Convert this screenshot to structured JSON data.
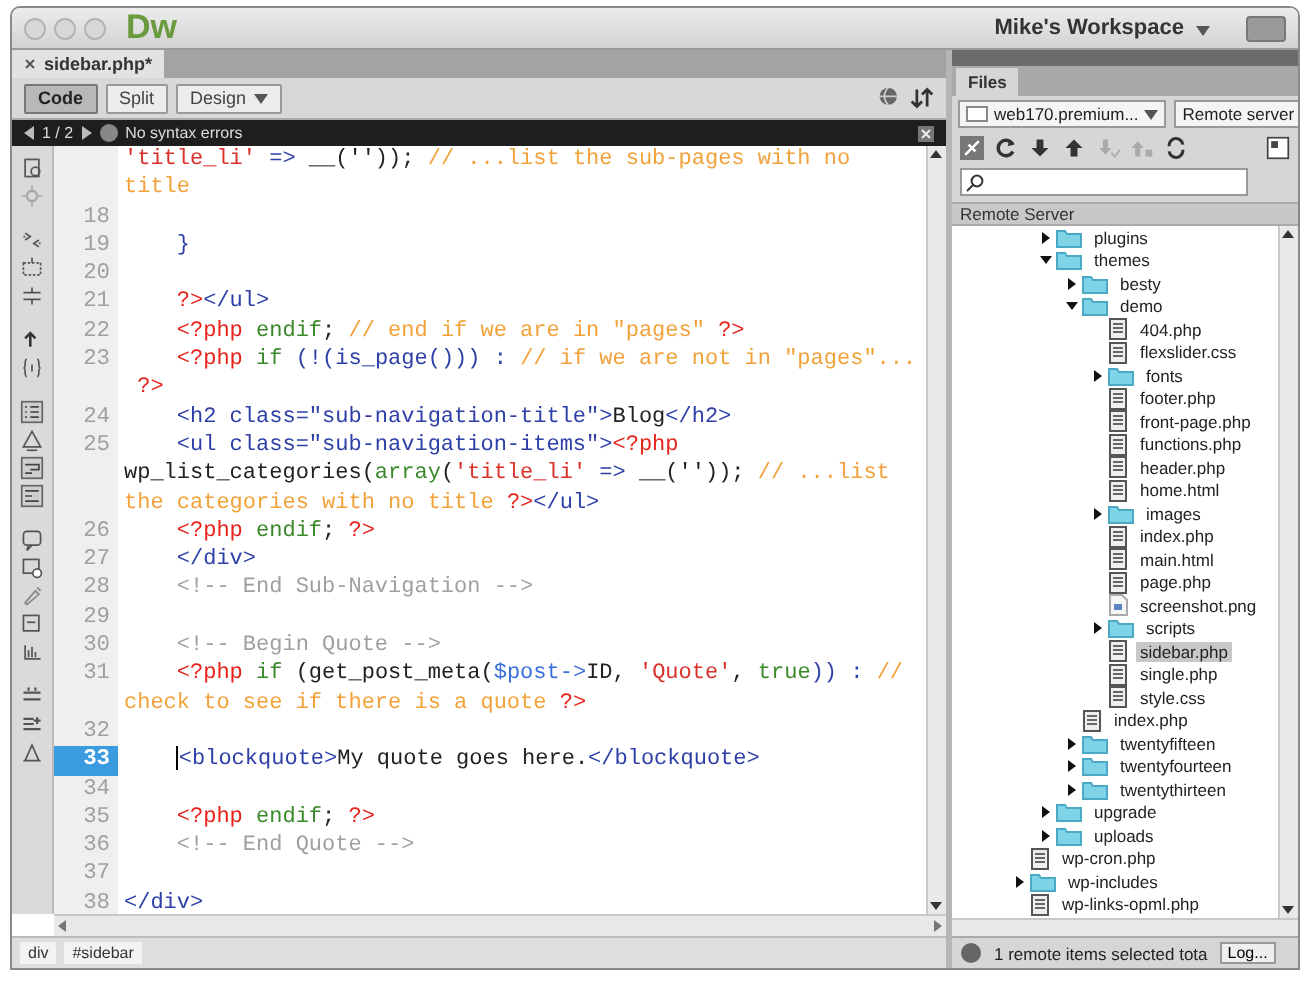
{
  "window": {
    "app_name": "Dw",
    "workspace": "Mike's Workspace"
  },
  "editor": {
    "tab": {
      "label": "sidebar.php*",
      "selected": true
    },
    "view_buttons": [
      {
        "label": "Code",
        "selected": true
      },
      {
        "label": "Split",
        "selected": false
      },
      {
        "label": "Design",
        "selected": false
      }
    ],
    "info_bar": {
      "pager": "1 / 2",
      "message": "No syntax errors"
    },
    "lines": [
      {
        "tokens": [
          {
            "kind": "string",
            "text": "'title_li'"
          },
          {
            "kind": "operator",
            "text": " => "
          },
          {
            "kind": "text",
            "text": "__('')); "
          },
          {
            "kind": "comment",
            "text": "// ...list the sub-pages with no"
          }
        ]
      },
      {
        "tokens": [
          {
            "kind": "comment",
            "text": "title"
          }
        ]
      },
      {
        "number": "18",
        "current": false
      },
      {
        "number": "19",
        "current": false,
        "tokens": [
          {
            "kind": "tag",
            "text": "    }"
          }
        ]
      },
      {
        "number": "20",
        "current": false
      },
      {
        "number": "21",
        "current": false,
        "tokens": [
          {
            "kind": "php",
            "text": "    ?>"
          },
          {
            "kind": "tag",
            "text": "</ul>"
          }
        ]
      },
      {
        "number": "22",
        "current": false,
        "tokens": [
          {
            "kind": "php",
            "text": "    <?php"
          },
          {
            "kind": "keyword",
            "text": " endif"
          },
          {
            "kind": "text",
            "text": "; "
          },
          {
            "kind": "comment",
            "text": "// end if we are in \"pages\" "
          },
          {
            "kind": "php",
            "text": "?>"
          }
        ]
      },
      {
        "number": "23",
        "current": false,
        "tokens": [
          {
            "kind": "php",
            "text": "    <?php"
          },
          {
            "kind": "keyword",
            "text": " if"
          },
          {
            "kind": "operator",
            "text": " (!(is_page())) : "
          },
          {
            "kind": "comment",
            "text": "// if we are not in \"pages\"..."
          }
        ]
      },
      {
        "tokens": [
          {
            "kind": "php",
            "text": " ?>"
          }
        ]
      },
      {
        "number": "24",
        "current": false,
        "tokens": [
          {
            "kind": "tag",
            "text": "    <h2 class=\"sub-navigation-title\">"
          },
          {
            "kind": "text",
            "text": "Blog"
          },
          {
            "kind": "tag",
            "text": "</h2>"
          }
        ]
      },
      {
        "number": "25",
        "current": false,
        "tokens": [
          {
            "kind": "tag",
            "text": "    <ul class=\"sub-navigation-items\">"
          },
          {
            "kind": "php",
            "text": "<?php"
          }
        ]
      },
      {
        "tokens": [
          {
            "kind": "text",
            "text": "wp_list_categories("
          },
          {
            "kind": "keyword",
            "text": "array"
          },
          {
            "kind": "text",
            "text": "("
          },
          {
            "kind": "string",
            "text": "'title_li'"
          },
          {
            "kind": "operator",
            "text": " => "
          },
          {
            "kind": "text",
            "text": "__('')); "
          },
          {
            "kind": "comment",
            "text": "// ...list"
          }
        ]
      },
      {
        "tokens": [
          {
            "kind": "comment",
            "text": "the categories with no title "
          },
          {
            "kind": "php",
            "text": "?>"
          },
          {
            "kind": "tag",
            "text": "</ul>"
          }
        ]
      },
      {
        "number": "26",
        "current": false,
        "tokens": [
          {
            "kind": "php",
            "text": "    <?php"
          },
          {
            "kind": "keyword",
            "text": " endif"
          },
          {
            "kind": "text",
            "text": "; "
          },
          {
            "kind": "php",
            "text": "?>"
          }
        ]
      },
      {
        "number": "27",
        "current": false,
        "tokens": [
          {
            "kind": "tag",
            "text": "    </div>"
          }
        ]
      },
      {
        "number": "28",
        "current": false,
        "tokens": [
          {
            "kind": "html_comment",
            "text": "    <!-- End Sub-Navigation -->"
          }
        ]
      },
      {
        "number": "29",
        "current": false
      },
      {
        "number": "30",
        "current": false,
        "tokens": [
          {
            "kind": "html_comment",
            "text": "    <!-- Begin Quote -->"
          }
        ]
      },
      {
        "number": "31",
        "current": false,
        "tokens": [
          {
            "kind": "php",
            "text": "    <?php"
          },
          {
            "kind": "keyword",
            "text": " if"
          },
          {
            "kind": "text",
            "text": " (get_post_meta("
          },
          {
            "kind": "variable",
            "text": "$post->"
          },
          {
            "kind": "text",
            "text": "ID, "
          },
          {
            "kind": "string",
            "text": "'Quote'"
          },
          {
            "kind": "text",
            "text": ", "
          },
          {
            "kind": "keyword",
            "text": "true"
          },
          {
            "kind": "operator",
            "text": ")) : "
          },
          {
            "kind": "comment",
            "text": "//"
          }
        ]
      },
      {
        "tokens": [
          {
            "kind": "comment",
            "text": "check to see if there is a quote "
          },
          {
            "kind": "php",
            "text": "?>"
          }
        ]
      },
      {
        "number": "32",
        "current": false
      },
      {
        "number": "33",
        "current": true,
        "tokens": [
          {
            "kind": "tag",
            "text": "    <blockquote>"
          },
          {
            "kind": "text",
            "text": "My quote goes here."
          },
          {
            "kind": "tag",
            "text": "</blockquote>"
          }
        ]
      },
      {
        "number": "34",
        "current": false
      },
      {
        "number": "35",
        "current": false,
        "tokens": [
          {
            "kind": "php",
            "text": "    <?php"
          },
          {
            "kind": "keyword",
            "text": " endif"
          },
          {
            "kind": "text",
            "text": "; "
          },
          {
            "kind": "php",
            "text": "?>"
          }
        ]
      },
      {
        "number": "36",
        "current": false,
        "tokens": [
          {
            "kind": "html_comment",
            "text": "    <!-- End Quote -->"
          }
        ]
      },
      {
        "number": "37",
        "current": false
      },
      {
        "number": "38",
        "current": false,
        "tokens": [
          {
            "kind": "tag",
            "text": "</div>"
          }
        ]
      }
    ],
    "status_bar": {
      "tags": [
        "div",
        "#sidebar"
      ]
    }
  },
  "files_panel": {
    "tab": "Files",
    "site": "web170.premium...",
    "view": "Remote server",
    "header": "Remote Server",
    "tree": [
      {
        "children": [
          {
            "label": "plugins",
            "kind": "folder",
            "expanded": false,
            "selected": false
          },
          {
            "label": "themes",
            "kind": "folder",
            "expanded": true,
            "selected": false,
            "children": [
              {
                "label": "besty",
                "kind": "folder",
                "expanded": false,
                "selected": false
              },
              {
                "label": "demo",
                "kind": "folder",
                "expanded": true,
                "selected": false,
                "children": [
                  {
                    "label": "404.php",
                    "kind": "file",
                    "selected": false
                  },
                  {
                    "label": "flexslider.css",
                    "kind": "file",
                    "selected": false
                  },
                  {
                    "label": "fonts",
                    "kind": "folder",
                    "expanded": false,
                    "selected": false
                  },
                  {
                    "label": "footer.php",
                    "kind": "file",
                    "selected": false
                  },
                  {
                    "label": "front-page.php",
                    "kind": "file",
                    "selected": false
                  },
                  {
                    "label": "functions.php",
                    "kind": "file",
                    "selected": false
                  },
                  {
                    "label": "header.php",
                    "kind": "file",
                    "selected": false
                  },
                  {
                    "label": "home.html",
                    "kind": "file",
                    "selected": false
                  },
                  {
                    "label": "images",
                    "kind": "folder",
                    "expanded": false,
                    "selected": false
                  },
                  {
                    "label": "index.php",
                    "kind": "file",
                    "selected": false
                  },
                  {
                    "label": "main.html",
                    "kind": "file",
                    "selected": false
                  },
                  {
                    "label": "page.php",
                    "kind": "file",
                    "selected": false
                  },
                  {
                    "label": "screenshot.png",
                    "kind": "image",
                    "selected": false
                  },
                  {
                    "label": "scripts",
                    "kind": "folder",
                    "expanded": false,
                    "selected": false
                  },
                  {
                    "label": "sidebar.php",
                    "kind": "file",
                    "selected": true
                  },
                  {
                    "label": "single.php",
                    "kind": "file",
                    "selected": false
                  },
                  {
                    "label": "style.css",
                    "kind": "file",
                    "selected": false
                  }
                ]
              },
              {
                "label": "index.php",
                "kind": "file",
                "selected": false
              },
              {
                "label": "twentyfifteen",
                "kind": "folder",
                "expanded": false,
                "selected": false
              },
              {
                "label": "twentyfourteen",
                "kind": "folder",
                "expanded": false,
                "selected": false
              },
              {
                "label": "twentythirteen",
                "kind": "folder",
                "expanded": false,
                "selected": false
              }
            ]
          },
          {
            "label": "upgrade",
            "kind": "folder",
            "expanded": false,
            "selected": false
          },
          {
            "label": "uploads",
            "kind": "folder",
            "expanded": false,
            "selected": false
          }
        ]
      },
      {
        "label": "wp-cron.php",
        "kind": "file",
        "selected": false
      },
      {
        "label": "wp-includes",
        "kind": "folder",
        "expanded": false,
        "selected": false
      },
      {
        "label": "wp-links-opml.php",
        "kind": "file",
        "selected": false
      }
    ],
    "status": "1 remote items selected tota",
    "log_button": "Log..."
  }
}
